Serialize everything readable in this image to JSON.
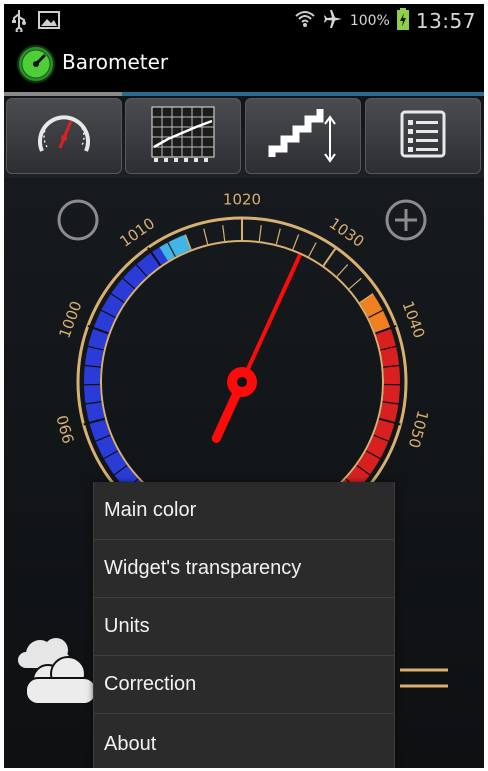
{
  "status_bar": {
    "battery_percent": "100%",
    "time": "13:57",
    "icons": [
      "usb-icon",
      "image-icon",
      "wifi-icon",
      "airplane-mode-icon",
      "battery-charging-icon"
    ]
  },
  "action_bar": {
    "title": "Barometer",
    "app_icon": "barometer-gauge-icon"
  },
  "tabs": [
    {
      "icon": "gauge-tab-icon"
    },
    {
      "icon": "graph-tab-icon"
    },
    {
      "icon": "altitude-stairs-tab-icon"
    },
    {
      "icon": "list-tab-icon"
    }
  ],
  "gauge": {
    "tick_labels": [
      "990",
      "1000",
      "1010",
      "1020",
      "1030",
      "1040",
      "1050"
    ],
    "needle_value": 1027,
    "colors": {
      "low": "#2a3bd8",
      "mid": "#3fb6e6",
      "high": "#d82020",
      "accent": "#f08020",
      "rim": "#d8b070"
    }
  },
  "buttons": {
    "left_icon": "circle-icon",
    "right_icon": "plus-circle-icon"
  },
  "weather": {
    "icon": "cloudy-icon"
  },
  "trend": {
    "icon": "trend-steady-icon"
  },
  "menu": {
    "items": [
      {
        "label": "Main color"
      },
      {
        "label": "Widget's transparency"
      },
      {
        "label": "Units"
      },
      {
        "label": "Correction"
      },
      {
        "label": "About"
      }
    ]
  }
}
